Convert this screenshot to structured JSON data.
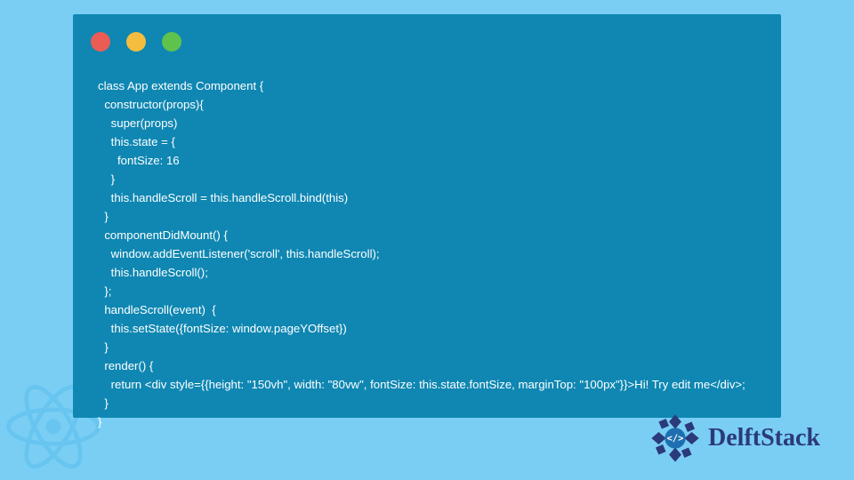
{
  "dots": {
    "red": "#eb5c54",
    "yellow": "#f4bd40",
    "green": "#5fc24c"
  },
  "code": "class App extends Component {\n  constructor(props){\n    super(props)\n    this.state = {\n      fontSize: 16\n    }\n    this.handleScroll = this.handleScroll.bind(this)\n  }\n  componentDidMount() {\n    window.addEventListener('scroll', this.handleScroll);\n    this.handleScroll();\n  };\n  handleScroll(event)  {\n    this.setState({fontSize: window.pageYOffset})\n  }\n  render() {\n    return <div style={{height: \"150vh\", width: \"80vw\", fontSize: this.state.fontSize, marginTop: \"100px\"}}>Hi! Try edit me</div>;\n  }\n}",
  "brand": "DelftStack",
  "brand_color": "#2b3a7a"
}
